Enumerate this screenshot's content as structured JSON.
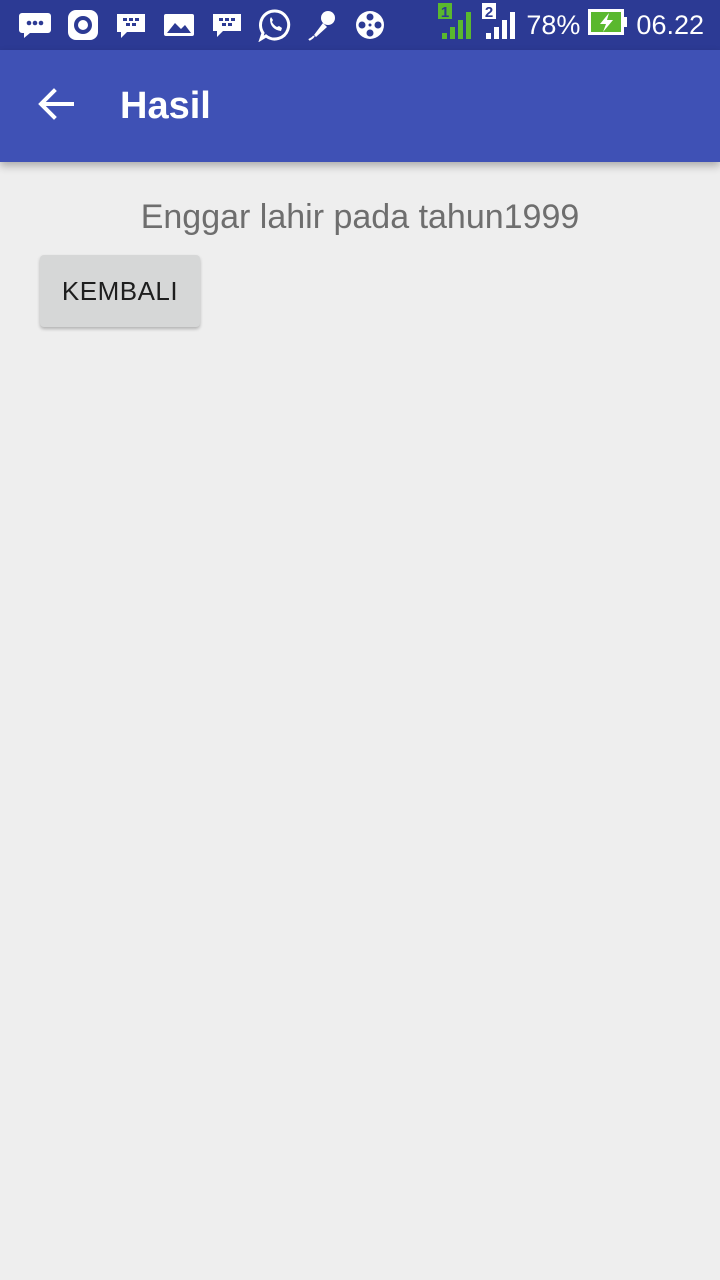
{
  "status_bar": {
    "battery": "78%",
    "time": "06.22",
    "sim1": "1",
    "sim2": "2",
    "icons": [
      "message-icon",
      "record-icon",
      "bbm-icon",
      "gallery-icon",
      "bbm-icon",
      "whatsapp-icon",
      "microphone-icon",
      "film-reel-icon",
      "signal-sim1-icon",
      "signal-sim2-icon",
      "battery-charging-icon"
    ]
  },
  "app_bar": {
    "title": "Hasil",
    "back_icon": "arrow-left-icon"
  },
  "main": {
    "result_text": "Enggar lahir pada tahun1999",
    "back_button_label": "KEMBALI"
  },
  "colors": {
    "status_bar": "#2c3a94",
    "app_bar": "#3f51b5",
    "background": "#eeeeee",
    "button": "#d6d7d7",
    "text": "#6e6e6e",
    "battery_green": "#5ab82e"
  }
}
